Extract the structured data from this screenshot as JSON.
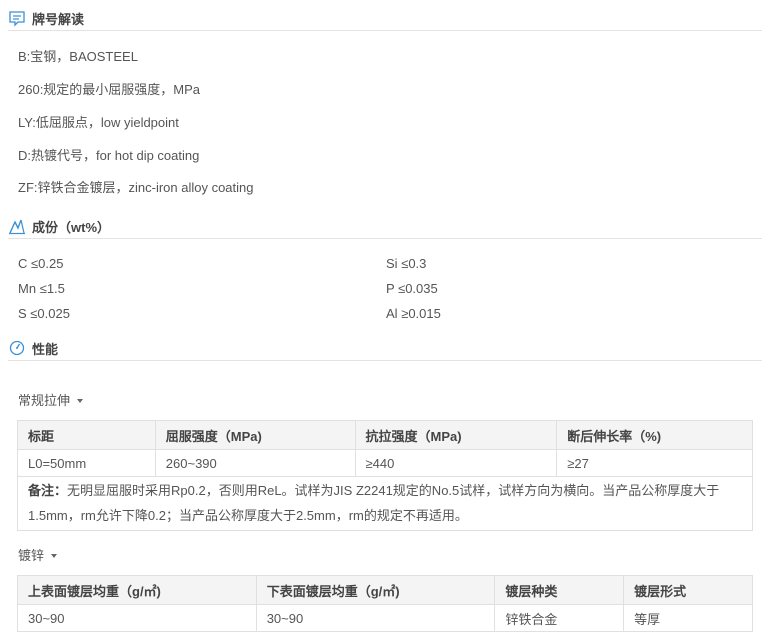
{
  "sections": {
    "brand": {
      "title": "牌号解读",
      "lines": [
        "B:宝钢，BAOSTEEL",
        "260:规定的最小屈服强度，MPa",
        "LY:低屈服点，low yieldpoint",
        "D:热镀代号，for hot dip coating",
        "ZF:锌铁合金镀层，zinc-iron alloy coating"
      ]
    },
    "composition": {
      "title": "成份（wt%）",
      "items": [
        {
          "el": "C",
          "val": "≤0.25"
        },
        {
          "el": "Si",
          "val": "≤0.3"
        },
        {
          "el": "Mn",
          "val": "≤1.5"
        },
        {
          "el": "P",
          "val": "≤0.035"
        },
        {
          "el": "S",
          "val": "≤0.025"
        },
        {
          "el": "Al",
          "val": "≥0.015"
        }
      ]
    },
    "performance": {
      "title": "性能",
      "tensile": {
        "dropdown_label": "常规拉伸",
        "headers": [
          "标距",
          "屈服强度（MPa)",
          "抗拉强度（MPa)",
          "断后伸长率（%)"
        ],
        "row": [
          "L0=50mm",
          "260~390",
          "≥440",
          "≥27"
        ],
        "note_label": "备注：",
        "note_text": "无明显屈服时采用Rp0.2，否则用ReL。试样为JIS Z2241规定的No.5试样，试样方向为横向。当产品公称厚度大于1.5mm，rm允许下降0.2；当产品公称厚度大于2.5mm，rm的规定不再适用。"
      },
      "coating": {
        "dropdown_label": "镀锌",
        "headers": [
          "上表面镀层均重（g/㎡)",
          "下表面镀层均重（g/㎡)",
          "镀层种类",
          "镀层形式"
        ],
        "row": [
          "30~90",
          "30~90",
          "锌铁合金",
          "等厚"
        ]
      }
    }
  },
  "colors": {
    "accent": "#3a8fd6",
    "border": "#e0e0e0",
    "header_bg": "#f4f4f4"
  },
  "icons": {
    "brand": "document-comment-icon",
    "composition": "flask-chart-icon",
    "performance": "gauge-icon"
  }
}
